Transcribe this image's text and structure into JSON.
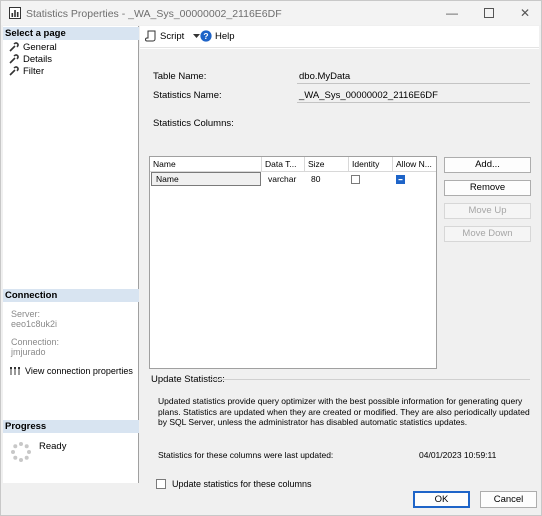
{
  "window": {
    "title": "Statistics Properties - _WA_Sys_00000002_2116E6DF",
    "minimize_glyph": "—",
    "maximize_glyph": "☐",
    "close_glyph": "✕"
  },
  "left_pane": {
    "select_page_header": "Select a page",
    "pages": [
      {
        "label": "General",
        "icon": "wrench-icon"
      },
      {
        "label": "Details",
        "icon": "wrench-icon"
      },
      {
        "label": "Filter",
        "icon": "wrench-icon"
      }
    ],
    "connection_header": "Connection",
    "server_label": "Server:",
    "server_value": "eeo1c8uk2i",
    "connection_label": "Connection:",
    "connection_value": "jmjurado",
    "view_connection_link": "View connection properties",
    "progress_header": "Progress",
    "progress_status": "Ready"
  },
  "toolbar": {
    "script_label": "Script",
    "help_label": "Help"
  },
  "form": {
    "table_name_label": "Table Name:",
    "table_name_value": "dbo.MyData",
    "statistics_name_label": "Statistics Name:",
    "statistics_name_value": "_WA_Sys_00000002_2116E6DF",
    "statistics_columns_label": "Statistics Columns:",
    "columns_headers": [
      "Name",
      "Data T...",
      "Size",
      "Identity",
      "Allow N..."
    ],
    "columns_rows": [
      {
        "name": "Name",
        "data_type": "varchar",
        "size": "80",
        "identity": false,
        "allow_nulls": true
      }
    ],
    "buttons": {
      "add": "Add...",
      "remove": "Remove",
      "move_up": "Move Up",
      "move_down": "Move Down"
    },
    "update_statistics_label": "Update Statistics:",
    "update_description": "Updated statistics provide query optimizer with the best possible information for generating query plans. Statistics are updated when they are created or modified. They are also periodically updated by SQL Server, unless the administrator has disabled automatic statistics updates.",
    "last_updated_label": "Statistics for these columns were last updated:",
    "last_updated_value": "04/01/2023 10:59:11",
    "update_checkbox_label": "Update statistics for these columns",
    "update_checkbox_checked": false
  },
  "footer": {
    "ok_label": "OK",
    "cancel_label": "Cancel"
  },
  "colors": {
    "accent": "#1e64c8",
    "section_header_bg": "#d8e4f1"
  }
}
